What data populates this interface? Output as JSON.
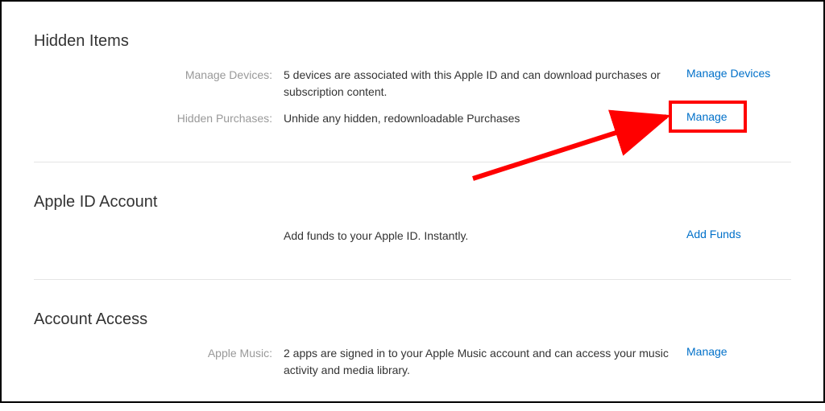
{
  "sections": {
    "hiddenItems": {
      "heading": "Hidden Items",
      "rows": {
        "manageDevices": {
          "label": "Manage Devices:",
          "value": "5 devices are associated with this Apple ID and can download purchases or subscription content.",
          "actionLabel": "Manage Devices"
        },
        "hiddenPurchases": {
          "label": "Hidden Purchases:",
          "value": "Unhide any hidden, redownloadable Purchases",
          "actionLabel": "Manage"
        }
      }
    },
    "appleIdAccount": {
      "heading": "Apple ID Account",
      "rows": {
        "addFunds": {
          "label": "",
          "value": "Add funds to your Apple ID. Instantly.",
          "actionLabel": "Add Funds"
        }
      }
    },
    "accountAccess": {
      "heading": "Account Access",
      "rows": {
        "appleMusic": {
          "label": "Apple Music:",
          "value": "2 apps are signed in to your Apple Music account and can access your music activity and media library.",
          "actionLabel": "Manage"
        }
      }
    }
  }
}
